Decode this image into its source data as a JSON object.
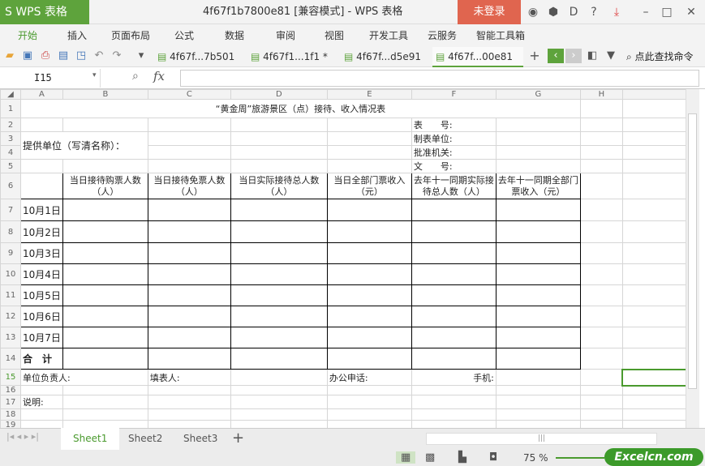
{
  "app": {
    "logo": "S WPS 表格",
    "title": "4f67f1b7800e81 [兼容模式] - WPS 表格",
    "login": "未登录"
  },
  "menu": [
    "开始",
    "插入",
    "页面布局",
    "公式",
    "数据",
    "审阅",
    "视图",
    "开发工具",
    "云服务",
    "智能工具箱"
  ],
  "doc_tabs": [
    "4f67f...7b501",
    "4f67f1...1f1 *",
    "4f67f...d5e91",
    "4f67f...00e81"
  ],
  "search_cmd": "点此查找命令",
  "formula_bar": {
    "cell_ref": "I15",
    "fx": "fx",
    "value": ""
  },
  "columns": [
    "A",
    "B",
    "C",
    "D",
    "E",
    "F",
    "G",
    "H",
    ""
  ],
  "sheet": {
    "title": "“黄金周”旅游景区（点）接待、收入情况表",
    "provider": "提供单位（写清名称）：",
    "meta": [
      "表　　号:",
      "制表单位:",
      "批准机关:",
      "文　　号:"
    ],
    "headers": [
      "当日接待购票人数（人）",
      "当日接待免票人数（人）",
      "当日实际接待总人数（人）",
      "当日全部门票收入（元）",
      "去年十一同期实际接待总人数（人）",
      "去年十一同期全部门票收入（元）"
    ],
    "dates": [
      "10月1日",
      "10月2日",
      "10月3日",
      "10月4日",
      "10月5日",
      "10月6日",
      "10月7日"
    ],
    "total": "合　计",
    "footer": {
      "leader": "单位负责人:",
      "filler": "填表人:",
      "phone": "办公申话:",
      "mobile": "手机:"
    },
    "note": "说明:"
  },
  "sheets": [
    "Sheet1",
    "Sheet2",
    "Sheet3"
  ],
  "status": {
    "zoom": "75 %",
    "brand": "Excelcn.com"
  }
}
